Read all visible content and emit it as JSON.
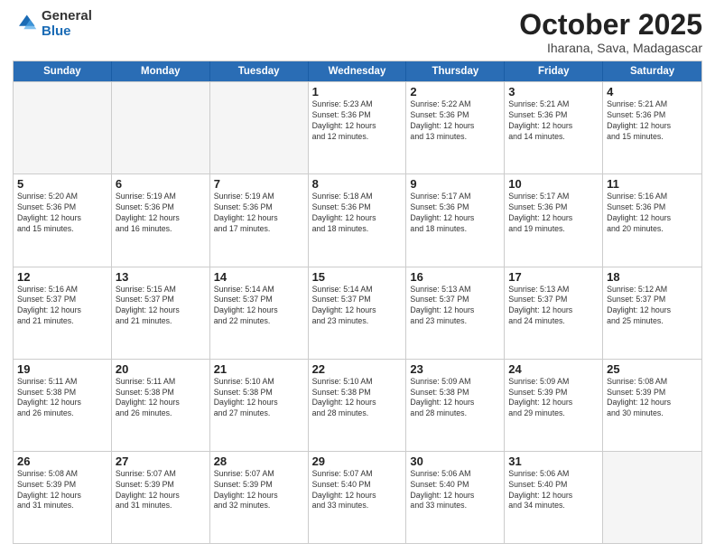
{
  "logo": {
    "general": "General",
    "blue": "Blue"
  },
  "header": {
    "month": "October 2025",
    "location": "Iharana, Sava, Madagascar"
  },
  "weekdays": [
    "Sunday",
    "Monday",
    "Tuesday",
    "Wednesday",
    "Thursday",
    "Friday",
    "Saturday"
  ],
  "rows": [
    [
      {
        "day": "",
        "info": "",
        "empty": true
      },
      {
        "day": "",
        "info": "",
        "empty": true
      },
      {
        "day": "",
        "info": "",
        "empty": true
      },
      {
        "day": "1",
        "info": "Sunrise: 5:23 AM\nSunset: 5:36 PM\nDaylight: 12 hours\nand 12 minutes."
      },
      {
        "day": "2",
        "info": "Sunrise: 5:22 AM\nSunset: 5:36 PM\nDaylight: 12 hours\nand 13 minutes."
      },
      {
        "day": "3",
        "info": "Sunrise: 5:21 AM\nSunset: 5:36 PM\nDaylight: 12 hours\nand 14 minutes."
      },
      {
        "day": "4",
        "info": "Sunrise: 5:21 AM\nSunset: 5:36 PM\nDaylight: 12 hours\nand 15 minutes."
      }
    ],
    [
      {
        "day": "5",
        "info": "Sunrise: 5:20 AM\nSunset: 5:36 PM\nDaylight: 12 hours\nand 15 minutes."
      },
      {
        "day": "6",
        "info": "Sunrise: 5:19 AM\nSunset: 5:36 PM\nDaylight: 12 hours\nand 16 minutes."
      },
      {
        "day": "7",
        "info": "Sunrise: 5:19 AM\nSunset: 5:36 PM\nDaylight: 12 hours\nand 17 minutes."
      },
      {
        "day": "8",
        "info": "Sunrise: 5:18 AM\nSunset: 5:36 PM\nDaylight: 12 hours\nand 18 minutes."
      },
      {
        "day": "9",
        "info": "Sunrise: 5:17 AM\nSunset: 5:36 PM\nDaylight: 12 hours\nand 18 minutes."
      },
      {
        "day": "10",
        "info": "Sunrise: 5:17 AM\nSunset: 5:36 PM\nDaylight: 12 hours\nand 19 minutes."
      },
      {
        "day": "11",
        "info": "Sunrise: 5:16 AM\nSunset: 5:36 PM\nDaylight: 12 hours\nand 20 minutes."
      }
    ],
    [
      {
        "day": "12",
        "info": "Sunrise: 5:16 AM\nSunset: 5:37 PM\nDaylight: 12 hours\nand 21 minutes."
      },
      {
        "day": "13",
        "info": "Sunrise: 5:15 AM\nSunset: 5:37 PM\nDaylight: 12 hours\nand 21 minutes."
      },
      {
        "day": "14",
        "info": "Sunrise: 5:14 AM\nSunset: 5:37 PM\nDaylight: 12 hours\nand 22 minutes."
      },
      {
        "day": "15",
        "info": "Sunrise: 5:14 AM\nSunset: 5:37 PM\nDaylight: 12 hours\nand 23 minutes."
      },
      {
        "day": "16",
        "info": "Sunrise: 5:13 AM\nSunset: 5:37 PM\nDaylight: 12 hours\nand 23 minutes."
      },
      {
        "day": "17",
        "info": "Sunrise: 5:13 AM\nSunset: 5:37 PM\nDaylight: 12 hours\nand 24 minutes."
      },
      {
        "day": "18",
        "info": "Sunrise: 5:12 AM\nSunset: 5:37 PM\nDaylight: 12 hours\nand 25 minutes."
      }
    ],
    [
      {
        "day": "19",
        "info": "Sunrise: 5:11 AM\nSunset: 5:38 PM\nDaylight: 12 hours\nand 26 minutes."
      },
      {
        "day": "20",
        "info": "Sunrise: 5:11 AM\nSunset: 5:38 PM\nDaylight: 12 hours\nand 26 minutes."
      },
      {
        "day": "21",
        "info": "Sunrise: 5:10 AM\nSunset: 5:38 PM\nDaylight: 12 hours\nand 27 minutes."
      },
      {
        "day": "22",
        "info": "Sunrise: 5:10 AM\nSunset: 5:38 PM\nDaylight: 12 hours\nand 28 minutes."
      },
      {
        "day": "23",
        "info": "Sunrise: 5:09 AM\nSunset: 5:38 PM\nDaylight: 12 hours\nand 28 minutes."
      },
      {
        "day": "24",
        "info": "Sunrise: 5:09 AM\nSunset: 5:39 PM\nDaylight: 12 hours\nand 29 minutes."
      },
      {
        "day": "25",
        "info": "Sunrise: 5:08 AM\nSunset: 5:39 PM\nDaylight: 12 hours\nand 30 minutes."
      }
    ],
    [
      {
        "day": "26",
        "info": "Sunrise: 5:08 AM\nSunset: 5:39 PM\nDaylight: 12 hours\nand 31 minutes."
      },
      {
        "day": "27",
        "info": "Sunrise: 5:07 AM\nSunset: 5:39 PM\nDaylight: 12 hours\nand 31 minutes."
      },
      {
        "day": "28",
        "info": "Sunrise: 5:07 AM\nSunset: 5:39 PM\nDaylight: 12 hours\nand 32 minutes."
      },
      {
        "day": "29",
        "info": "Sunrise: 5:07 AM\nSunset: 5:40 PM\nDaylight: 12 hours\nand 33 minutes."
      },
      {
        "day": "30",
        "info": "Sunrise: 5:06 AM\nSunset: 5:40 PM\nDaylight: 12 hours\nand 33 minutes."
      },
      {
        "day": "31",
        "info": "Sunrise: 5:06 AM\nSunset: 5:40 PM\nDaylight: 12 hours\nand 34 minutes."
      },
      {
        "day": "",
        "info": "",
        "empty": true
      }
    ]
  ]
}
